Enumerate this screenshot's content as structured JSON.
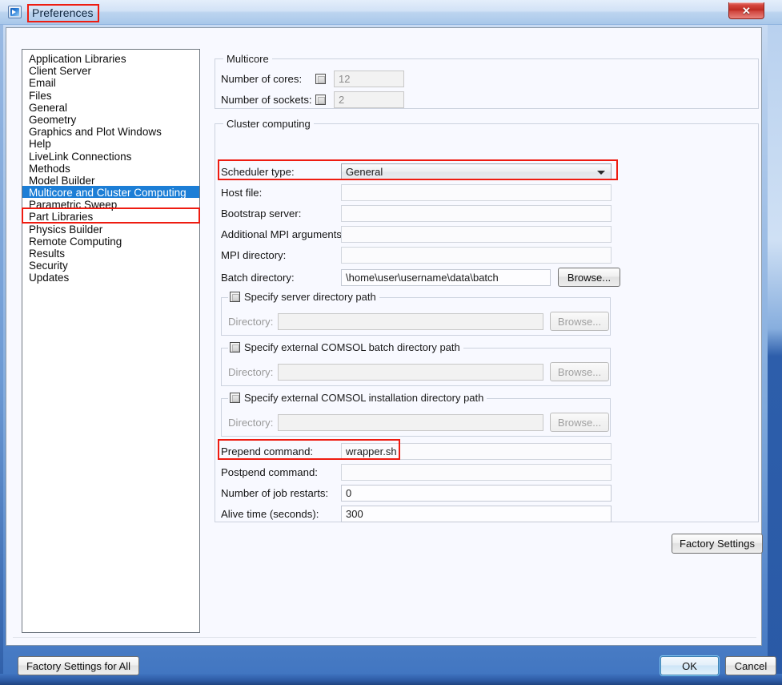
{
  "window": {
    "title": "Preferences",
    "icon": "comsol-app-icon",
    "close_label": "✕"
  },
  "sidebar": {
    "items": [
      {
        "label": "Application Libraries",
        "selected": false
      },
      {
        "label": "Client Server",
        "selected": false
      },
      {
        "label": "Email",
        "selected": false
      },
      {
        "label": "Files",
        "selected": false
      },
      {
        "label": "General",
        "selected": false
      },
      {
        "label": "Geometry",
        "selected": false
      },
      {
        "label": "Graphics and Plot Windows",
        "selected": false
      },
      {
        "label": "Help",
        "selected": false
      },
      {
        "label": "LiveLink Connections",
        "selected": false
      },
      {
        "label": "Methods",
        "selected": false
      },
      {
        "label": "Model Builder",
        "selected": false
      },
      {
        "label": "Multicore and Cluster Computing",
        "selected": true
      },
      {
        "label": "Parametric Sweep",
        "selected": false
      },
      {
        "label": "Part Libraries",
        "selected": false
      },
      {
        "label": "Physics Builder",
        "selected": false
      },
      {
        "label": "Remote Computing",
        "selected": false
      },
      {
        "label": "Results",
        "selected": false
      },
      {
        "label": "Security",
        "selected": false
      },
      {
        "label": "Updates",
        "selected": false
      }
    ]
  },
  "multicore": {
    "group_title": "Multicore",
    "cores": {
      "label": "Number of cores:",
      "value": "12",
      "checked": false
    },
    "sockets": {
      "label": "Number of sockets:",
      "value": "2",
      "checked": false
    }
  },
  "cluster": {
    "group_title": "Cluster computing",
    "scheduler": {
      "label": "Scheduler type:",
      "value": "General"
    },
    "host_file": {
      "label": "Host file:",
      "value": ""
    },
    "bootstrap_server": {
      "label": "Bootstrap server:",
      "value": ""
    },
    "additional_mpi_arguments": {
      "label": "Additional MPI arguments:",
      "value": ""
    },
    "mpi_directory": {
      "label": "MPI directory:",
      "value": ""
    },
    "batch_directory": {
      "label": "Batch directory:",
      "value": "\\home\\user\\username\\data\\batch",
      "browse_label": "Browse..."
    },
    "server_dir": {
      "title": "Specify server directory path",
      "checked": false,
      "dir_label": "Directory:",
      "dir_value": "",
      "browse_label": "Browse..."
    },
    "batch_dir_external": {
      "title": "Specify external COMSOL batch directory path",
      "checked": false,
      "dir_label": "Directory:",
      "dir_value": "",
      "browse_label": "Browse..."
    },
    "install_dir_external": {
      "title": "Specify external COMSOL installation directory path",
      "checked": false,
      "dir_label": "Directory:",
      "dir_value": "",
      "browse_label": "Browse..."
    },
    "prepend_command": {
      "label": "Prepend command:",
      "value": "wrapper.sh"
    },
    "postpend_command": {
      "label": "Postpend command:",
      "value": ""
    },
    "job_restarts": {
      "label": "Number of job restarts:",
      "value": "0"
    },
    "alive_time": {
      "label": "Alive time (seconds):",
      "value": "300"
    }
  },
  "buttons": {
    "factory_settings": "Factory Settings",
    "factory_settings_for_all": "Factory Settings for All",
    "ok": "OK",
    "cancel": "Cancel"
  },
  "colors": {
    "selection_blue": "#1c7ed6",
    "annotation_red": "#ee1c11",
    "pane_background": "#f8f9ff",
    "titlebar_start": "#e4eefb",
    "close_button_red": "#bb2a22"
  }
}
